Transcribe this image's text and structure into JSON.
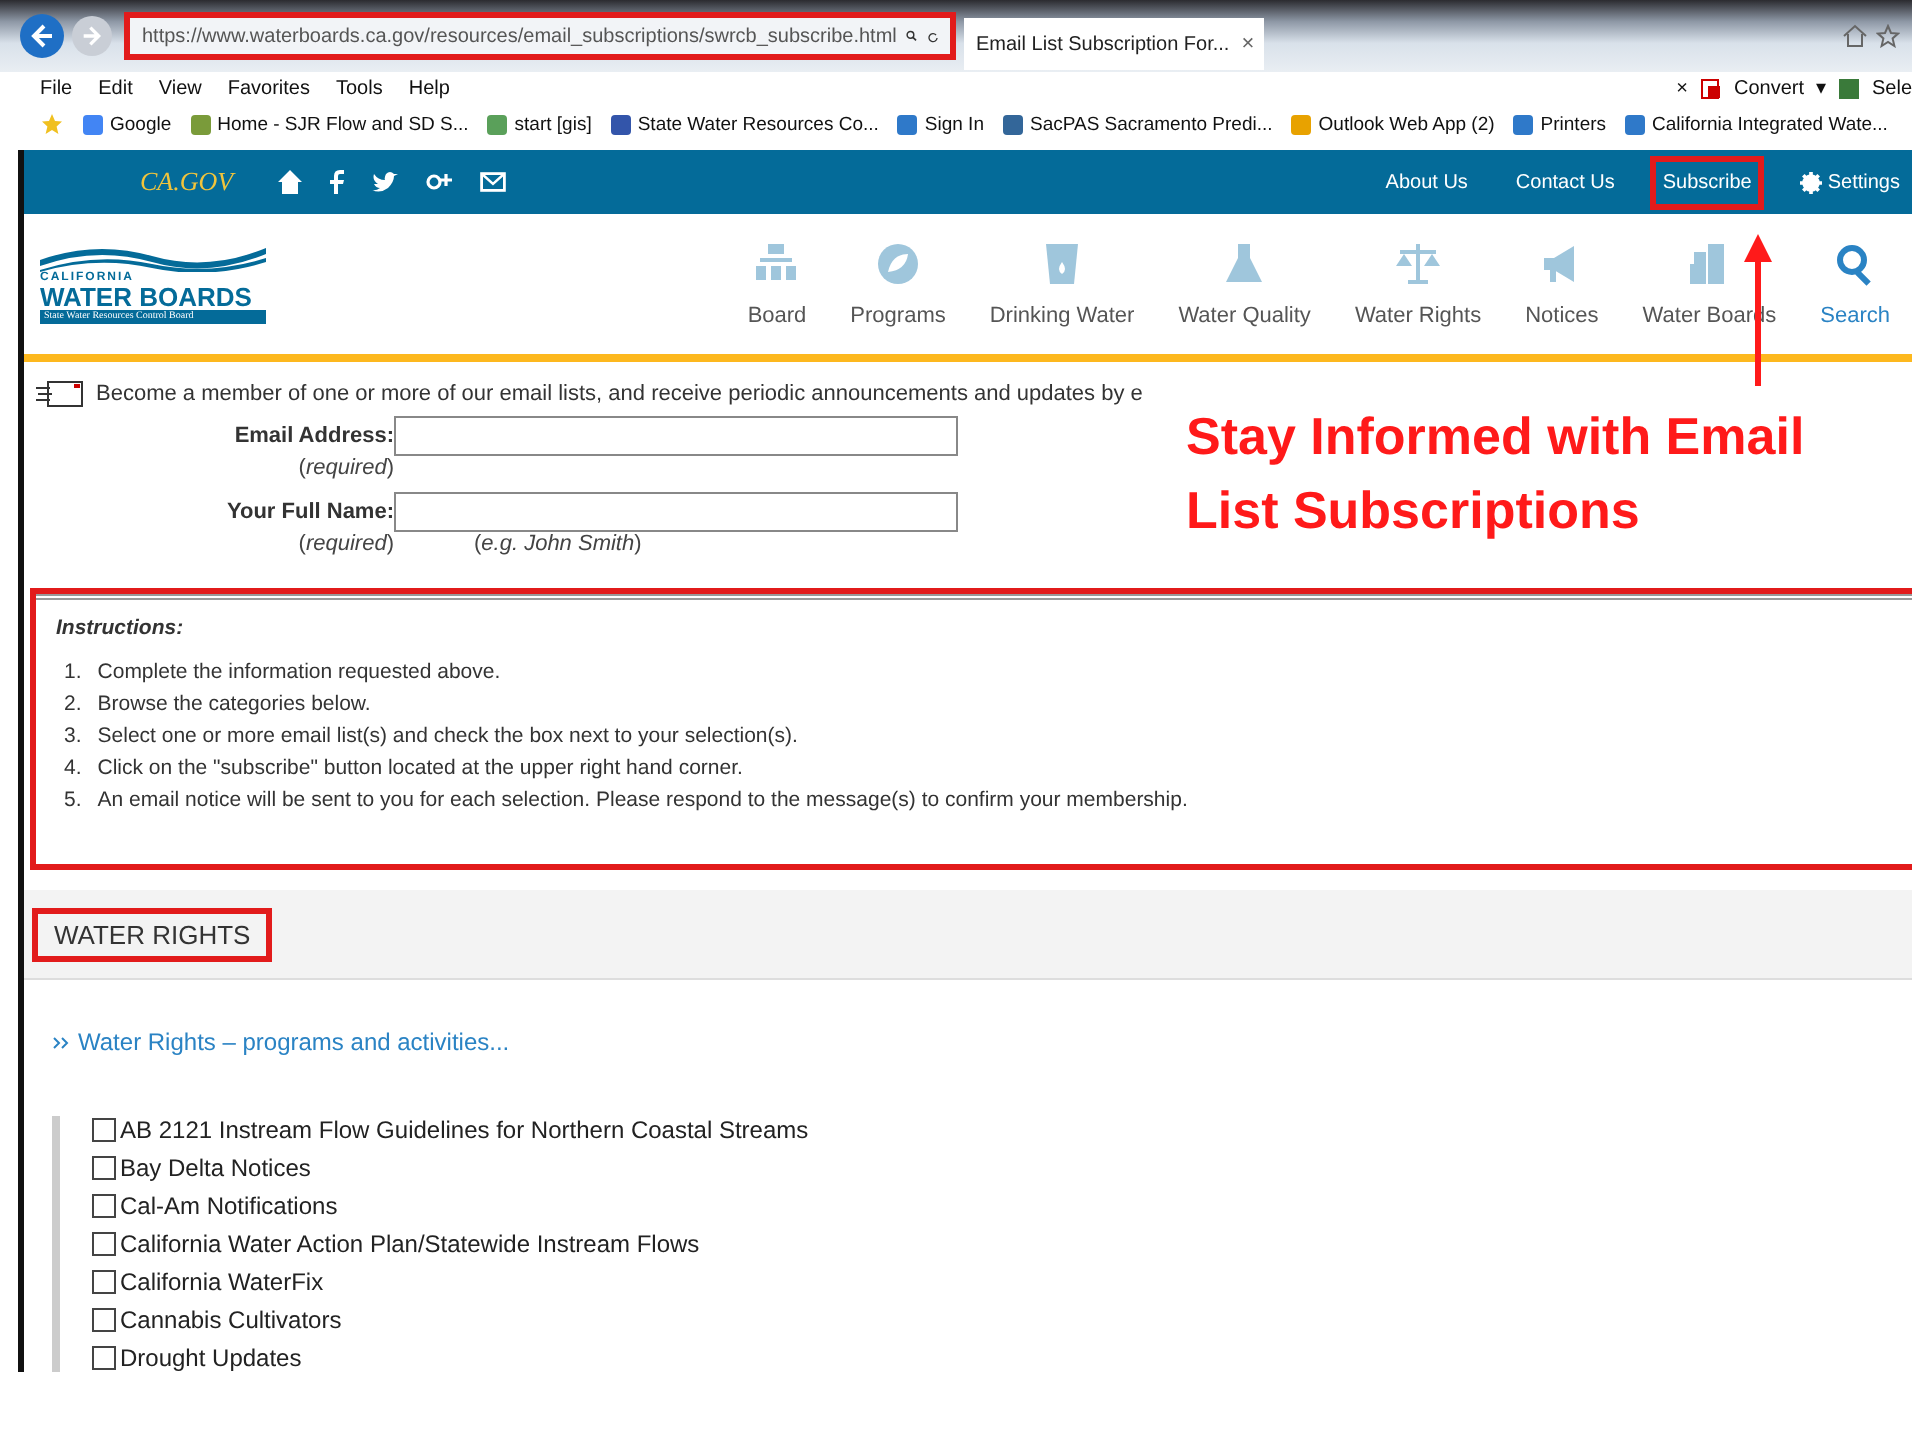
{
  "browser": {
    "address": {
      "url": "https://www.waterboards.ca.gov/resources/email_subscriptions/swrcb_subscribe.html",
      "highlighted": true
    },
    "tab": {
      "title": "Email List Subscription For...",
      "close": "×"
    },
    "menu": [
      "File",
      "Edit",
      "View",
      "Favorites",
      "Tools",
      "Help"
    ],
    "menu_right": {
      "close": "×",
      "convert": "Convert",
      "caret": "▾",
      "select": "Sele"
    },
    "favorites": [
      "Google",
      "Home - SJR Flow and SD S...",
      "start [gis]",
      "State Water Resources Co...",
      "Sign In",
      "SacPAS Sacramento Predi...",
      "Outlook Web App (2)",
      "Printers",
      "California Integrated Wate..."
    ]
  },
  "site_bar": {
    "logo": "CA.GOV",
    "links": [
      {
        "label": "About Us",
        "highlighted": false
      },
      {
        "label": "Contact Us",
        "highlighted": false
      },
      {
        "label": "Subscribe",
        "highlighted": true
      },
      {
        "label": "Settings",
        "highlighted": false
      }
    ]
  },
  "header": {
    "logo": {
      "top": "CALIFORNIA",
      "main": "WATER BOARDS",
      "sub": "State Water Resources Control Board"
    },
    "nav": [
      {
        "label": "Board",
        "kind": "link"
      },
      {
        "label": "Programs",
        "kind": "link"
      },
      {
        "label": "Drinking Water",
        "kind": "link"
      },
      {
        "label": "Water Quality",
        "kind": "link"
      },
      {
        "label": "Water Rights",
        "kind": "link"
      },
      {
        "label": "Notices",
        "kind": "link"
      },
      {
        "label": "Water Boards",
        "kind": "link"
      },
      {
        "label": "Search",
        "kind": "search"
      }
    ]
  },
  "intro": "Become a member of one or more of our email lists, and receive periodic announcements and updates by e",
  "form": [
    {
      "label": "Email Address:",
      "note": "(*required*)"
    },
    {
      "label": "Your Full Name:",
      "note": "(*required*)",
      "example": "(*e.g. John Smith*)"
    }
  ],
  "annotation": "Stay Informed with Email List Subscriptions",
  "instructions": {
    "title": "Instructions:",
    "highlighted": true,
    "steps": [
      {
        "number": "1.",
        "text": "Complete the information requested above."
      },
      {
        "number": "2.",
        "text": "Browse the categories below."
      },
      {
        "number": "3.",
        "text": "Select one or more email list(s) and check the box next to your selection(s)."
      },
      {
        "number": "4.",
        "text": "Click on the \"subscribe\" button located at the upper right hand corner."
      },
      {
        "number": "5.",
        "text": "An email notice will be sent to you for each selection. Please respond to the message(s) to confirm your membership."
      }
    ]
  },
  "section": {
    "title": "WATER RIGHTS",
    "highlighted": true,
    "link": "Water Rights – programs and activities...",
    "lists": [
      {
        "label": "AB 2121 Instream Flow Guidelines for Northern Coastal Streams",
        "checked": false
      },
      {
        "label": "Bay Delta Notices",
        "checked": false
      },
      {
        "label": "Cal-Am Notifications",
        "checked": false
      },
      {
        "label": "California Water Action Plan/Statewide Instream Flows",
        "checked": false
      },
      {
        "label": "California WaterFix",
        "checked": false
      },
      {
        "label": "Cannabis Cultivators",
        "checked": false
      },
      {
        "label": "Drought Updates",
        "checked": false
      }
    ]
  }
}
